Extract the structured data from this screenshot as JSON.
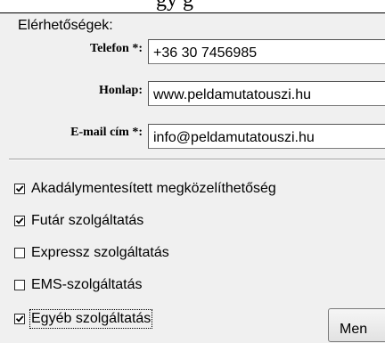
{
  "top_cutoff_text": "gy     g",
  "section_title": "Elérhetőségek:",
  "fields": {
    "phone": {
      "label": "Telefon *:",
      "value": "+36 30 7456985"
    },
    "website": {
      "label": "Honlap:",
      "value": "www.peldamutatouszi.hu"
    },
    "email": {
      "label": "E-mail cím *:",
      "value": "info@peldamutatouszi.hu"
    }
  },
  "checkboxes": [
    {
      "label": "Akadálymentesített megközelíthetőség",
      "checked": true
    },
    {
      "label": "Futár szolgáltatás",
      "checked": true
    },
    {
      "label": "Expressz szolgáltatás",
      "checked": false
    },
    {
      "label": "EMS-szolgáltatás",
      "checked": false
    },
    {
      "label": "Egyéb szolgáltatás",
      "checked": true
    }
  ],
  "button_label": "Men"
}
